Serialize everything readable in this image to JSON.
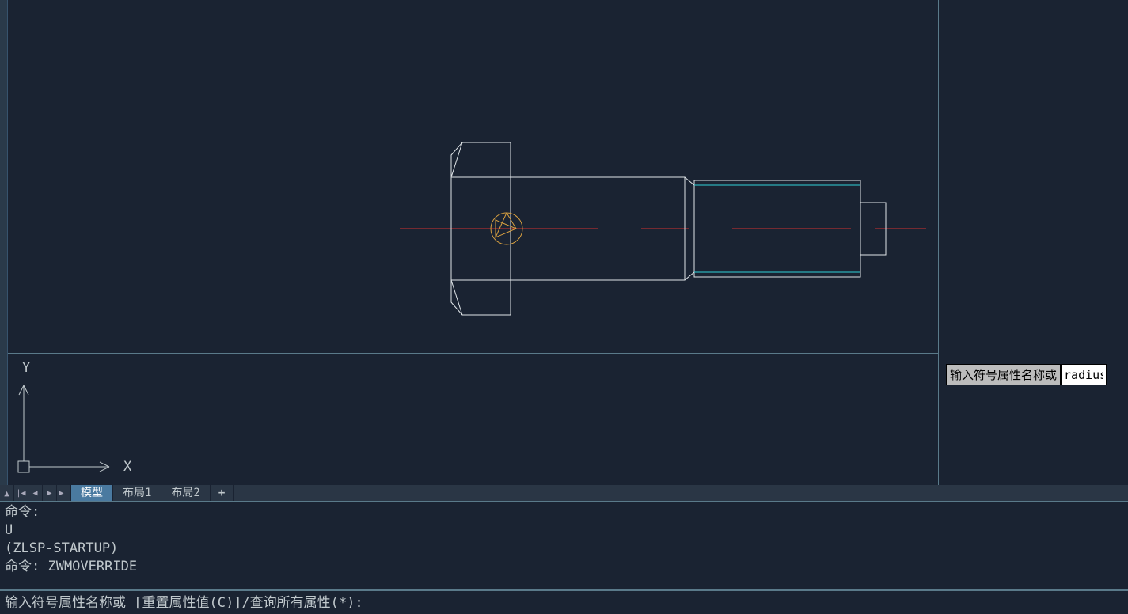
{
  "ucs": {
    "x_label": "X",
    "y_label": "Y"
  },
  "floating_input": {
    "label": "输入符号属性名称或",
    "value": "radius"
  },
  "tabs": {
    "model": "模型",
    "layout1": "布局1",
    "layout2": "布局2",
    "add": "+"
  },
  "command_history": {
    "line1": "命令:",
    "line2": "U",
    "line3": "(ZLSP-STARTUP)",
    "line4": "命令: ZWMOVERRIDE"
  },
  "command_prompt": "输入符号属性名称或 [重置属性值(C)]/查询所有属性(*):"
}
